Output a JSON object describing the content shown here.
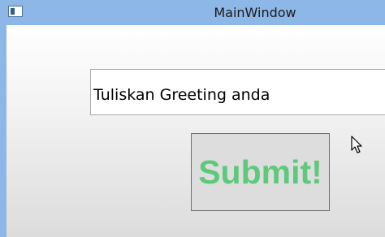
{
  "window": {
    "title": "MainWindow"
  },
  "form": {
    "greeting_value": "Tuliskan Greeting anda",
    "submit_label": "Submit!"
  },
  "icons": {
    "app": "app-window-icon",
    "cursor": "mouse-cursor-icon"
  },
  "colors": {
    "titlebar": "#8db7e6",
    "submit_text": "#5ec97a",
    "submit_background": "#dddddd"
  }
}
